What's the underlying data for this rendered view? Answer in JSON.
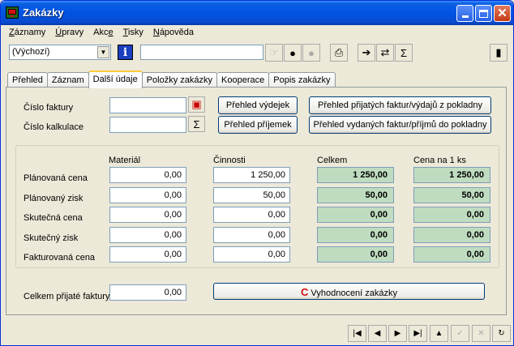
{
  "window": {
    "title": "Zakázky"
  },
  "menu": [
    {
      "pre": "",
      "ul": "Z",
      "post": "áznamy"
    },
    {
      "pre": "",
      "ul": "Ú",
      "post": "pravy"
    },
    {
      "pre": "Akc",
      "ul": "e",
      "post": ""
    },
    {
      "pre": "",
      "ul": "T",
      "post": "isky"
    },
    {
      "pre": "",
      "ul": "N",
      "post": "ápověda"
    }
  ],
  "toolbar": {
    "view_selected": "(Výchozí)",
    "search_value": ""
  },
  "tabs": [
    "Přehled",
    "Záznam",
    "Další údaje",
    "Položky zakázky",
    "Kooperace",
    "Popis zakázky"
  ],
  "active_tab": "Další údaje",
  "form": {
    "invoice_no_label": "Číslo faktury",
    "invoice_no_value": "",
    "calc_no_label": "Číslo kalkulace",
    "calc_no_value": "",
    "btn_issues": "Přehled výdejek",
    "btn_receipts": "Přehled příjemek",
    "btn_received_invoices": "Přehled přijatých faktur/výdajů z pokladny",
    "btn_issued_invoices": "Přehled vydaných faktur/příjmů do pokladny"
  },
  "grid": {
    "columns": [
      "Materiál",
      "Činnosti",
      "Celkem",
      "Cena na 1 ks"
    ],
    "rows": [
      {
        "label": "Plánovaná cena",
        "material": "0,00",
        "cinnosti": "1 250,00",
        "celkem": "1 250,00",
        "cena_ks": "1 250,00"
      },
      {
        "label": "Plánovaný zisk",
        "material": "0,00",
        "cinnosti": "50,00",
        "celkem": "50,00",
        "cena_ks": "50,00"
      },
      {
        "label": "Skutečná cena",
        "material": "0,00",
        "cinnosti": "0,00",
        "celkem": "0,00",
        "cena_ks": "0,00"
      },
      {
        "label": "Skutečný zisk",
        "material": "0,00",
        "cinnosti": "0,00",
        "celkem": "0,00",
        "cena_ks": "0,00"
      },
      {
        "label": "Fakturovaná cena",
        "material": "0,00",
        "cinnosti": "0,00",
        "celkem": "0,00",
        "cena_ks": "0,00"
      }
    ]
  },
  "footer": {
    "received_total_label": "Celkem přijaté faktury",
    "received_total_value": "0,00",
    "evaluate_button": "Vyhodnocení zakázky"
  },
  "colors": {
    "titlebar": "#0054E3",
    "calc_field": "#C0DCC0",
    "face": "#ECE9D8"
  }
}
